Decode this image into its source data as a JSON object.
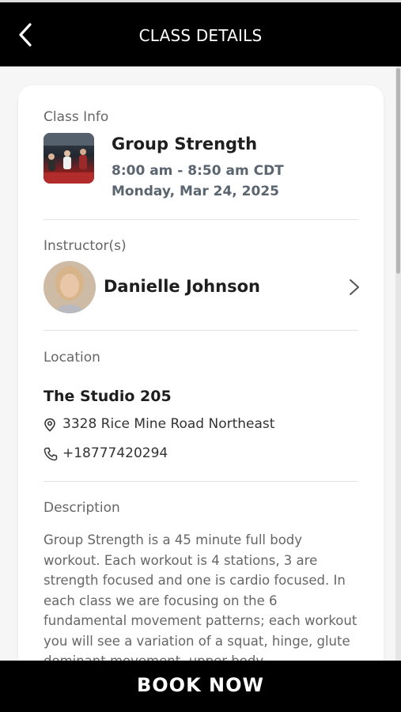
{
  "header": {
    "back_icon": "chevron-left-icon",
    "title": "CLASS DETAILS"
  },
  "class_info": {
    "label": "Class Info",
    "name": "Group Strength",
    "time": "8:00 am - 8:50 am CDT",
    "date": "Monday, Mar 24, 2025"
  },
  "instructor": {
    "label": "Instructor(s)",
    "name": "Danielle Johnson",
    "chevron_icon": "chevron-right-icon"
  },
  "location": {
    "label": "Location",
    "name": "The Studio 205",
    "address_icon": "map-pin-icon",
    "address": "3328 Rice Mine Road Northeast",
    "phone_icon": "phone-icon",
    "phone": "+18777420294"
  },
  "description": {
    "label": "Description",
    "text": "Group Strength is a 45 minute full body workout. Each workout is 4 stations, 3 are strength focused and one is cardio focused. In each class we are focusing on the 6 fundamental movement patterns; each workout you will see a variation of a squat, hinge, glute dominant movement, upper body"
  },
  "footer": {
    "book_label": "BOOK NOW"
  },
  "colors": {
    "header_bg": "#000000",
    "book_bg": "#000000",
    "secondary_text": "#5a6570"
  }
}
